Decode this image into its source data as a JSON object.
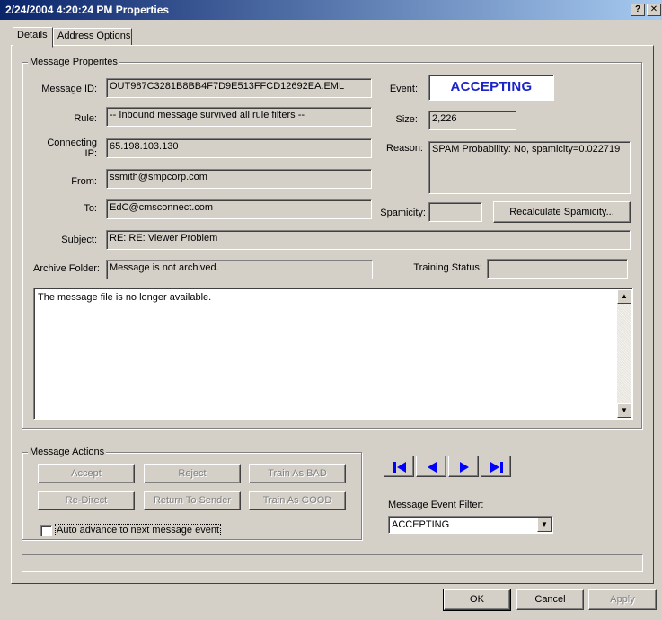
{
  "window": {
    "title": "2/24/2004 4:20:24 PM Properties",
    "help_glyph": "?",
    "close_glyph": "✕"
  },
  "tabs": [
    {
      "label": "Details",
      "active": true
    },
    {
      "label": "Address Options",
      "active": false
    }
  ],
  "message_properties": {
    "group_label": "Message Properites",
    "message_id_label": "Message ID:",
    "message_id": "OUT987C3281B8BB4F7D9E513FFCD12692EA.EML",
    "rule_label": "Rule:",
    "rule": "-- Inbound message survived all rule filters --",
    "connecting_ip_label_line1": "Connecting",
    "connecting_ip_label_line2": "IP:",
    "connecting_ip": "65.198.103.130",
    "from_label": "From:",
    "from": "ssmith@smpcorp.com",
    "to_label": "To:",
    "to": "EdC@cmsconnect.com",
    "subject_label": "Subject:",
    "subject": "RE:  RE: Viewer Problem",
    "archive_folder_label": "Archive Folder:",
    "archive_folder": "Message is not archived.",
    "event_label": "Event:",
    "event": "ACCEPTING",
    "size_label": "Size:",
    "size": "2,226",
    "reason_label": "Reason:",
    "reason": "SPAM Probability: No, spamicity=0.022719",
    "spamicity_label": "Spamicity:",
    "spamicity": "",
    "recalculate_button": "Recalculate Spamicity...",
    "training_status_label": "Training Status:",
    "training_status": "",
    "body_text": "The message file is no longer available."
  },
  "message_actions": {
    "group_label": "Message Actions",
    "accept": "Accept",
    "reject": "Reject",
    "train_bad": "Train As BAD",
    "redirect": "Re-Direct",
    "return_to_sender": "Return To Sender",
    "train_good": "Train As GOOD",
    "auto_advance_label": "Auto advance to next message event",
    "auto_advance_checked": false
  },
  "navigation": {
    "first_icon": "skip-to-first-icon",
    "prev_icon": "previous-icon",
    "next_icon": "next-icon",
    "last_icon": "skip-to-last-icon",
    "filter_label": "Message Event Filter:",
    "filter_value": "ACCEPTING",
    "icon_color": "#0000ff"
  },
  "footer": {
    "ok": "OK",
    "cancel": "Cancel",
    "apply": "Apply"
  }
}
